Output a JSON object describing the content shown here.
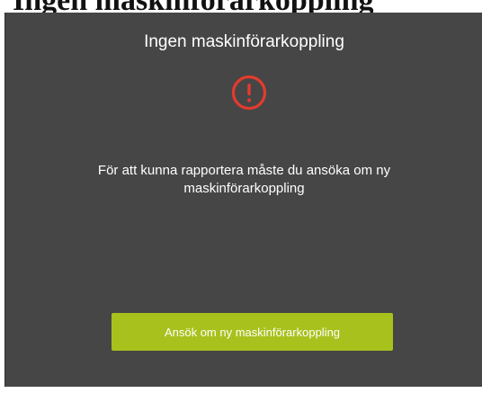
{
  "background_title": "Ingen maskinförarkoppling",
  "dialog": {
    "title": "Ingen maskinförarkoppling",
    "message": "För att kunna rapportera måste du ansöka om ny maskinförarkoppling",
    "icon": "alert-circle-icon",
    "button_label": "Ansök om ny maskinförarkoppling"
  },
  "colors": {
    "dialog_background": "#464646",
    "alert_red": "#e33b2e",
    "button_green": "#a9c11d",
    "text": "#ffffff"
  }
}
